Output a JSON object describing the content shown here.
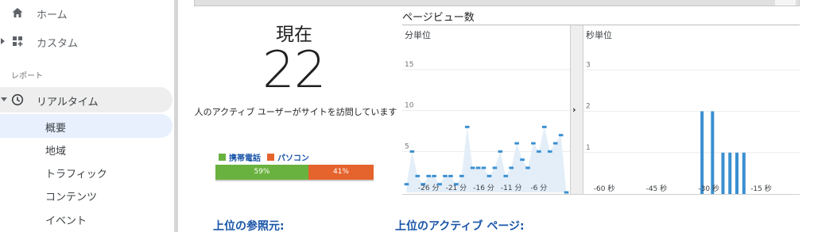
{
  "sidebar": {
    "home": {
      "label": "ホーム",
      "icon": "home-icon"
    },
    "custom": {
      "label": "カスタム",
      "icon": "dashboard-grid-icon"
    },
    "section_reports": "レポート",
    "realtime": {
      "label": "リアルタイム",
      "icon": "clock-icon"
    },
    "subitems": [
      "概要",
      "地域",
      "トラフィック",
      "コンテンツ",
      "イベント"
    ],
    "active_subitem": "概要"
  },
  "now": {
    "title": "現在",
    "count": "22",
    "description": "人のアクティブ ユーザーがサイトを訪問しています"
  },
  "devices": {
    "mobile_label": "携帯電話",
    "pc_label": "パソコン",
    "mobile_percent": "59%",
    "pc_percent": "41%",
    "mobile_value": 59,
    "pc_value": 41,
    "mobile_color": "#6ab23f",
    "pc_color": "#e5632c"
  },
  "pageviews": {
    "title": "ページビュー数",
    "minute_label": "分単位",
    "second_label": "秒単位"
  },
  "chart_data": [
    {
      "type": "line",
      "title": "分単位",
      "ylim": [
        0,
        18
      ],
      "yticks": [
        "5",
        "10",
        "15"
      ],
      "ytick_values": [
        5,
        10,
        15
      ],
      "xticks": [
        "-26 分",
        "-21 分",
        "-16 分",
        "-11 分",
        "-6 分"
      ],
      "xtick_values": [
        -26,
        -21,
        -16,
        -11,
        -6
      ],
      "grid": true,
      "color": "#3a8fd1",
      "series": [
        {
          "x": [
            -30,
            -29,
            -28,
            -27,
            -26,
            -25,
            -24,
            -23,
            -22,
            -21,
            -20,
            -19,
            -18,
            -17,
            -16,
            -15,
            -14,
            -13,
            -12,
            -11,
            -10,
            -9,
            -8,
            -7,
            -6,
            -5,
            -4,
            -3,
            -2,
            -1
          ],
          "values": [
            1,
            5,
            2,
            1,
            2,
            2,
            1,
            2,
            2,
            1,
            2,
            8,
            3,
            3,
            3,
            2,
            3,
            5,
            2,
            3,
            6,
            4,
            3,
            6,
            5,
            8,
            5,
            6,
            7,
            0
          ]
        }
      ]
    },
    {
      "type": "bar",
      "title": "秒単位",
      "ylim": [
        0,
        3.6
      ],
      "yticks": [
        "1",
        "2",
        "3"
      ],
      "ytick_values": [
        1,
        2,
        3
      ],
      "xticks": [
        "-60 秒",
        "-45 秒",
        "-30 秒",
        "-15 秒"
      ],
      "xtick_values": [
        -60,
        -45,
        -30,
        -15
      ],
      "grid": true,
      "color": "#3a8fd1",
      "x": [
        -28,
        -25,
        -22,
        -20,
        -18,
        -16
      ],
      "values": [
        2,
        2,
        1,
        1,
        1,
        1
      ]
    }
  ],
  "sections": {
    "top_referrers": "上位の参照元:",
    "top_active_pages": "上位のアクティブ ページ:"
  }
}
